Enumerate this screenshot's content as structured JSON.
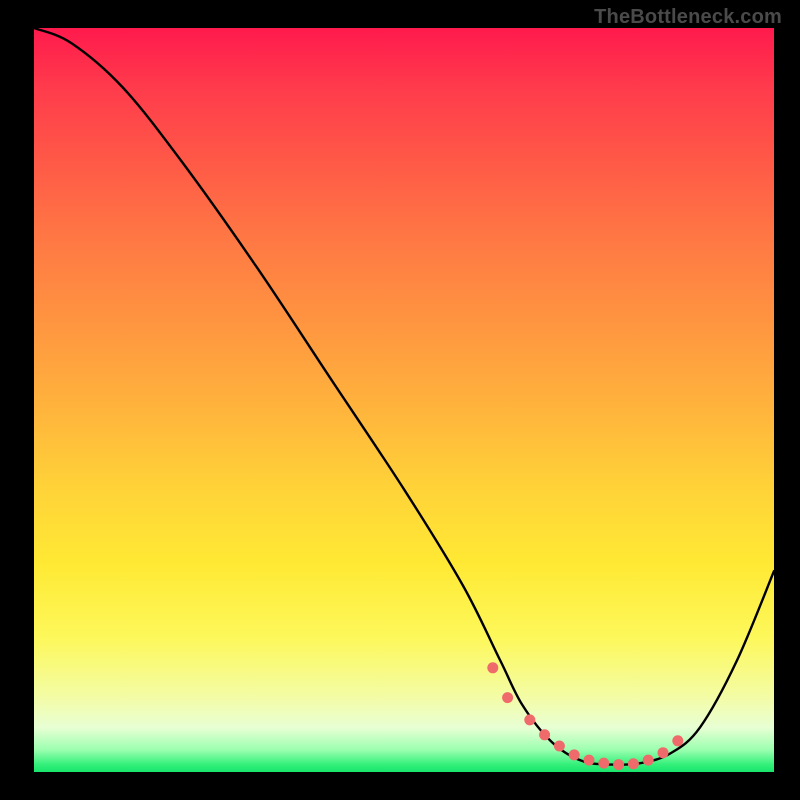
{
  "watermark": "TheBottleneck.com",
  "chart_data": {
    "type": "line",
    "title": "",
    "xlabel": "",
    "ylabel": "",
    "xlim": [
      0,
      100
    ],
    "ylim": [
      0,
      100
    ],
    "series": [
      {
        "name": "bottleneck-curve",
        "x": [
          0,
          5,
          12,
          20,
          30,
          40,
          50,
          58,
          63,
          66,
          70,
          74,
          78,
          82,
          86,
          90,
          95,
          100
        ],
        "values": [
          100,
          98,
          92,
          82,
          68,
          53,
          38,
          25,
          15,
          9,
          4,
          1.5,
          1,
          1.2,
          2.5,
          6,
          15,
          27
        ]
      }
    ],
    "markers": {
      "name": "highlight-dots",
      "color": "#ef6b6b",
      "x": [
        62,
        64,
        67,
        69,
        71,
        73,
        75,
        77,
        79,
        81,
        83,
        85,
        87
      ],
      "values": [
        14,
        10,
        7,
        5,
        3.5,
        2.3,
        1.6,
        1.2,
        1.0,
        1.1,
        1.6,
        2.6,
        4.2
      ]
    },
    "gradient_stops": [
      {
        "pos": 0,
        "color": "#ff1a4d"
      },
      {
        "pos": 50,
        "color": "#ffb63c"
      },
      {
        "pos": 85,
        "color": "#fdf85b"
      },
      {
        "pos": 100,
        "color": "#18e46c"
      }
    ]
  }
}
